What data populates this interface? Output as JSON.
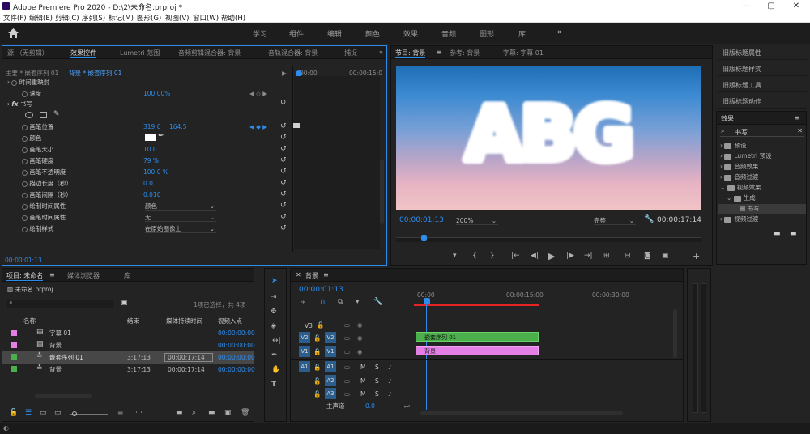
{
  "title_bar": {
    "title": "Adobe Premiere Pro 2020 - D:\\2\\未命名.prproj *",
    "minimize": "—",
    "maximize": "▢",
    "close": "✕"
  },
  "menu": [
    "文件(F)",
    "编辑(E)",
    "剪辑(C)",
    "序列(S)",
    "标记(M)",
    "图形(G)",
    "视图(V)",
    "窗口(W)",
    "帮助(H)"
  ],
  "workspaces": [
    "学习",
    "组件",
    "编辑",
    "颜色",
    "效果",
    "音频",
    "图形",
    "库"
  ],
  "colors": {
    "accent": "#2d8ceb",
    "clip_green": "#4bb04b",
    "clip_pink": "#e47fe6",
    "playhead": "#2d8ceb",
    "work_red": "#e82323"
  },
  "effect_controls": {
    "tabs": [
      "源:（无剪辑）",
      "效果控件",
      "Lumetri 范围",
      "音频剪辑混合器: 背景",
      "音轨混合器: 背景",
      "捕捉"
    ],
    "master": "主要 * 嵌套序列 01",
    "clip": "背景 * 嵌套序列 01",
    "ruler_start": "00:00",
    "ruler_end": "00:00:15:0",
    "time_remap": "时间重映射",
    "speed_label": "速度",
    "speed_value": "100.00%",
    "effect_name": "书写",
    "rows": [
      {
        "label": "画笔位置",
        "value": "319.0",
        "value2": "164.5"
      },
      {
        "label": "颜色",
        "value": ""
      },
      {
        "label": "画笔大小",
        "value": "10.0"
      },
      {
        "label": "画笔硬度",
        "value": "79 %"
      },
      {
        "label": "画笔不透明度",
        "value": "100.0 %"
      },
      {
        "label": "描边长度（秒）",
        "value": "0.0"
      },
      {
        "label": "画笔间隔（秒）",
        "value": "0.010"
      },
      {
        "label": "绘制时间属性",
        "value": "颜色"
      },
      {
        "label": "画笔时间属性",
        "value": "无"
      },
      {
        "label": "绘制样式",
        "value": "在原始图像上"
      }
    ],
    "timecode": "00:00:01:13"
  },
  "program_monitor": {
    "tabs": [
      "节目: 背景",
      "参考: 背景",
      "字幕: 字幕 01"
    ],
    "cloud_text": "ABG",
    "timecode": "00:00:01:13",
    "zoom": "200%",
    "quality": "完整",
    "duration": "00:00:17:14",
    "playhead_fraction": 0.09
  },
  "legacy_title": [
    "旧版标题属性",
    "旧版标题样式",
    "旧版标题工具",
    "旧版标题动作"
  ],
  "effects": {
    "tab": "效果",
    "search": "书写",
    "items": [
      {
        "label": "预设",
        "indent": 0
      },
      {
        "label": "Lumetri 预设",
        "indent": 0
      },
      {
        "label": "音频效果",
        "indent": 0
      },
      {
        "label": "音频过渡",
        "indent": 0
      },
      {
        "label": "视频效果",
        "indent": 0
      },
      {
        "label": "生成",
        "indent": 1
      },
      {
        "label": "书写",
        "indent": 2
      },
      {
        "label": "视频过渡",
        "indent": 0
      }
    ]
  },
  "project": {
    "tabs": [
      "项目: 未命名",
      "媒体浏览器",
      "库"
    ],
    "file": "未命名.prproj",
    "selection": "1项已选择，共 4项",
    "columns": [
      "名称",
      "结束",
      "媒体持续时间",
      "视频入点"
    ],
    "rows": [
      {
        "name": "字幕 01",
        "end": "",
        "duration": "",
        "in": "00:00:00:00",
        "color": "#e47fe6"
      },
      {
        "name": "背景",
        "end": "",
        "duration": "",
        "in": "00:00:00:00",
        "color": "#e47fe6"
      },
      {
        "name": "嵌套序列 01",
        "end": "3:17:13",
        "duration": "00:00:17:14",
        "in": "00:00:00:00",
        "color": "#4bb04b"
      },
      {
        "name": "背景",
        "end": "3:17:13",
        "duration": "00:00:17:14",
        "in": "00:00:00:00",
        "color": "#4bb04b"
      }
    ]
  },
  "timeline": {
    "tab": "背景",
    "timecode": "00:00:01:13",
    "ruler": [
      "00:00",
      "00:00:15:00",
      "00:00:30:00"
    ],
    "tracks_video": [
      "V3",
      "V2",
      "V1"
    ],
    "tracks_audio": [
      "A1",
      "A2",
      "A3"
    ],
    "master": "主声道",
    "master_value": "0.0",
    "clip_v2": "嵌套序列 01",
    "clip_v1": "背景",
    "audio_btn_m": "M",
    "audio_btn_s": "S"
  }
}
